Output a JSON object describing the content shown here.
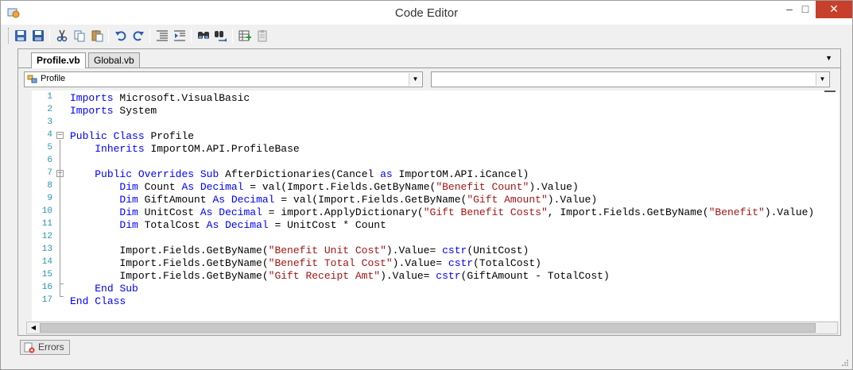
{
  "window": {
    "title": "Code Editor"
  },
  "toolbar": {
    "buttons": [
      {
        "name": "save-icon"
      },
      {
        "name": "save-all-icon"
      },
      {
        "name": "cut-icon"
      },
      {
        "name": "copy-icon"
      },
      {
        "name": "paste-icon"
      },
      {
        "name": "undo-icon"
      },
      {
        "name": "redo-icon"
      },
      {
        "name": "indent-icon"
      },
      {
        "name": "outdent-icon"
      },
      {
        "name": "find-icon"
      },
      {
        "name": "replace-icon"
      },
      {
        "name": "insert-field-icon"
      },
      {
        "name": "clipboard-icon"
      }
    ]
  },
  "tabs": [
    {
      "label": "Profile.vb",
      "active": true
    },
    {
      "label": "Global.vb",
      "active": false
    }
  ],
  "combos": {
    "left": {
      "value": "Profile"
    },
    "right": {
      "value": ""
    }
  },
  "code": {
    "line_numbers": [
      "1",
      "2",
      "3",
      "4",
      "5",
      "6",
      "7",
      "8",
      "9",
      "10",
      "11",
      "12",
      "13",
      "14",
      "15",
      "16",
      "17"
    ],
    "lines": [
      [
        {
          "t": "Imports",
          "c": "kw"
        },
        {
          "t": " Microsoft.VisualBasic"
        }
      ],
      [
        {
          "t": "Imports",
          "c": "kw"
        },
        {
          "t": " System"
        }
      ],
      [],
      [
        {
          "t": "Public",
          "c": "kw"
        },
        {
          "t": " "
        },
        {
          "t": "Class",
          "c": "kw"
        },
        {
          "t": " Profile"
        }
      ],
      [
        {
          "t": "    "
        },
        {
          "t": "Inherits",
          "c": "kw"
        },
        {
          "t": " ImportOM.API.ProfileBase"
        }
      ],
      [],
      [
        {
          "t": "    "
        },
        {
          "t": "Public",
          "c": "kw"
        },
        {
          "t": " "
        },
        {
          "t": "Overrides",
          "c": "kw"
        },
        {
          "t": " "
        },
        {
          "t": "Sub",
          "c": "kw"
        },
        {
          "t": " AfterDictionaries(Cancel "
        },
        {
          "t": "as",
          "c": "kw"
        },
        {
          "t": " ImportOM.API.iCancel)"
        }
      ],
      [
        {
          "t": "        "
        },
        {
          "t": "Dim",
          "c": "kw"
        },
        {
          "t": " Count "
        },
        {
          "t": "As",
          "c": "kw"
        },
        {
          "t": " "
        },
        {
          "t": "Decimal",
          "c": "kw"
        },
        {
          "t": " = val(Import.Fields.GetByName("
        },
        {
          "t": "\"Benefit Count\"",
          "c": "str"
        },
        {
          "t": ").Value)"
        }
      ],
      [
        {
          "t": "        "
        },
        {
          "t": "Dim",
          "c": "kw"
        },
        {
          "t": " GiftAmount "
        },
        {
          "t": "As",
          "c": "kw"
        },
        {
          "t": " "
        },
        {
          "t": "Decimal",
          "c": "kw"
        },
        {
          "t": " = val(Import.Fields.GetByName("
        },
        {
          "t": "\"Gift Amount\"",
          "c": "str"
        },
        {
          "t": ").Value)"
        }
      ],
      [
        {
          "t": "        "
        },
        {
          "t": "Dim",
          "c": "kw"
        },
        {
          "t": " UnitCost "
        },
        {
          "t": "As",
          "c": "kw"
        },
        {
          "t": " "
        },
        {
          "t": "Decimal",
          "c": "kw"
        },
        {
          "t": " = import.ApplyDictionary("
        },
        {
          "t": "\"Gift Benefit Costs\"",
          "c": "str"
        },
        {
          "t": ", Import.Fields.GetByName("
        },
        {
          "t": "\"Benefit\"",
          "c": "str"
        },
        {
          "t": ").Value)"
        }
      ],
      [
        {
          "t": "        "
        },
        {
          "t": "Dim",
          "c": "kw"
        },
        {
          "t": " TotalCost "
        },
        {
          "t": "As",
          "c": "kw"
        },
        {
          "t": " "
        },
        {
          "t": "Decimal",
          "c": "kw"
        },
        {
          "t": " = UnitCost * Count"
        }
      ],
      [],
      [
        {
          "t": "        Import.Fields.GetByName("
        },
        {
          "t": "\"Benefit Unit Cost\"",
          "c": "str"
        },
        {
          "t": ").Value= "
        },
        {
          "t": "cstr",
          "c": "kw"
        },
        {
          "t": "(UnitCost)"
        }
      ],
      [
        {
          "t": "        Import.Fields.GetByName("
        },
        {
          "t": "\"Benefit Total Cost\"",
          "c": "str"
        },
        {
          "t": ").Value= "
        },
        {
          "t": "cstr",
          "c": "kw"
        },
        {
          "t": "(TotalCost)"
        }
      ],
      [
        {
          "t": "        Import.Fields.GetByName("
        },
        {
          "t": "\"Gift Receipt Amt\"",
          "c": "str"
        },
        {
          "t": ").Value= "
        },
        {
          "t": "cstr",
          "c": "kw"
        },
        {
          "t": "(GiftAmount - TotalCost)"
        }
      ],
      [
        {
          "t": "    "
        },
        {
          "t": "End",
          "c": "kw"
        },
        {
          "t": " "
        },
        {
          "t": "Sub",
          "c": "kw"
        }
      ],
      [
        {
          "t": "End",
          "c": "kw"
        },
        {
          "t": " "
        },
        {
          "t": "Class",
          "c": "kw"
        }
      ]
    ]
  },
  "bottom": {
    "errors_tab": "Errors"
  },
  "colors": {
    "keyword": "#0000ff",
    "string": "#a31515",
    "line_number": "#2b91af",
    "close_button": "#c7402b"
  }
}
